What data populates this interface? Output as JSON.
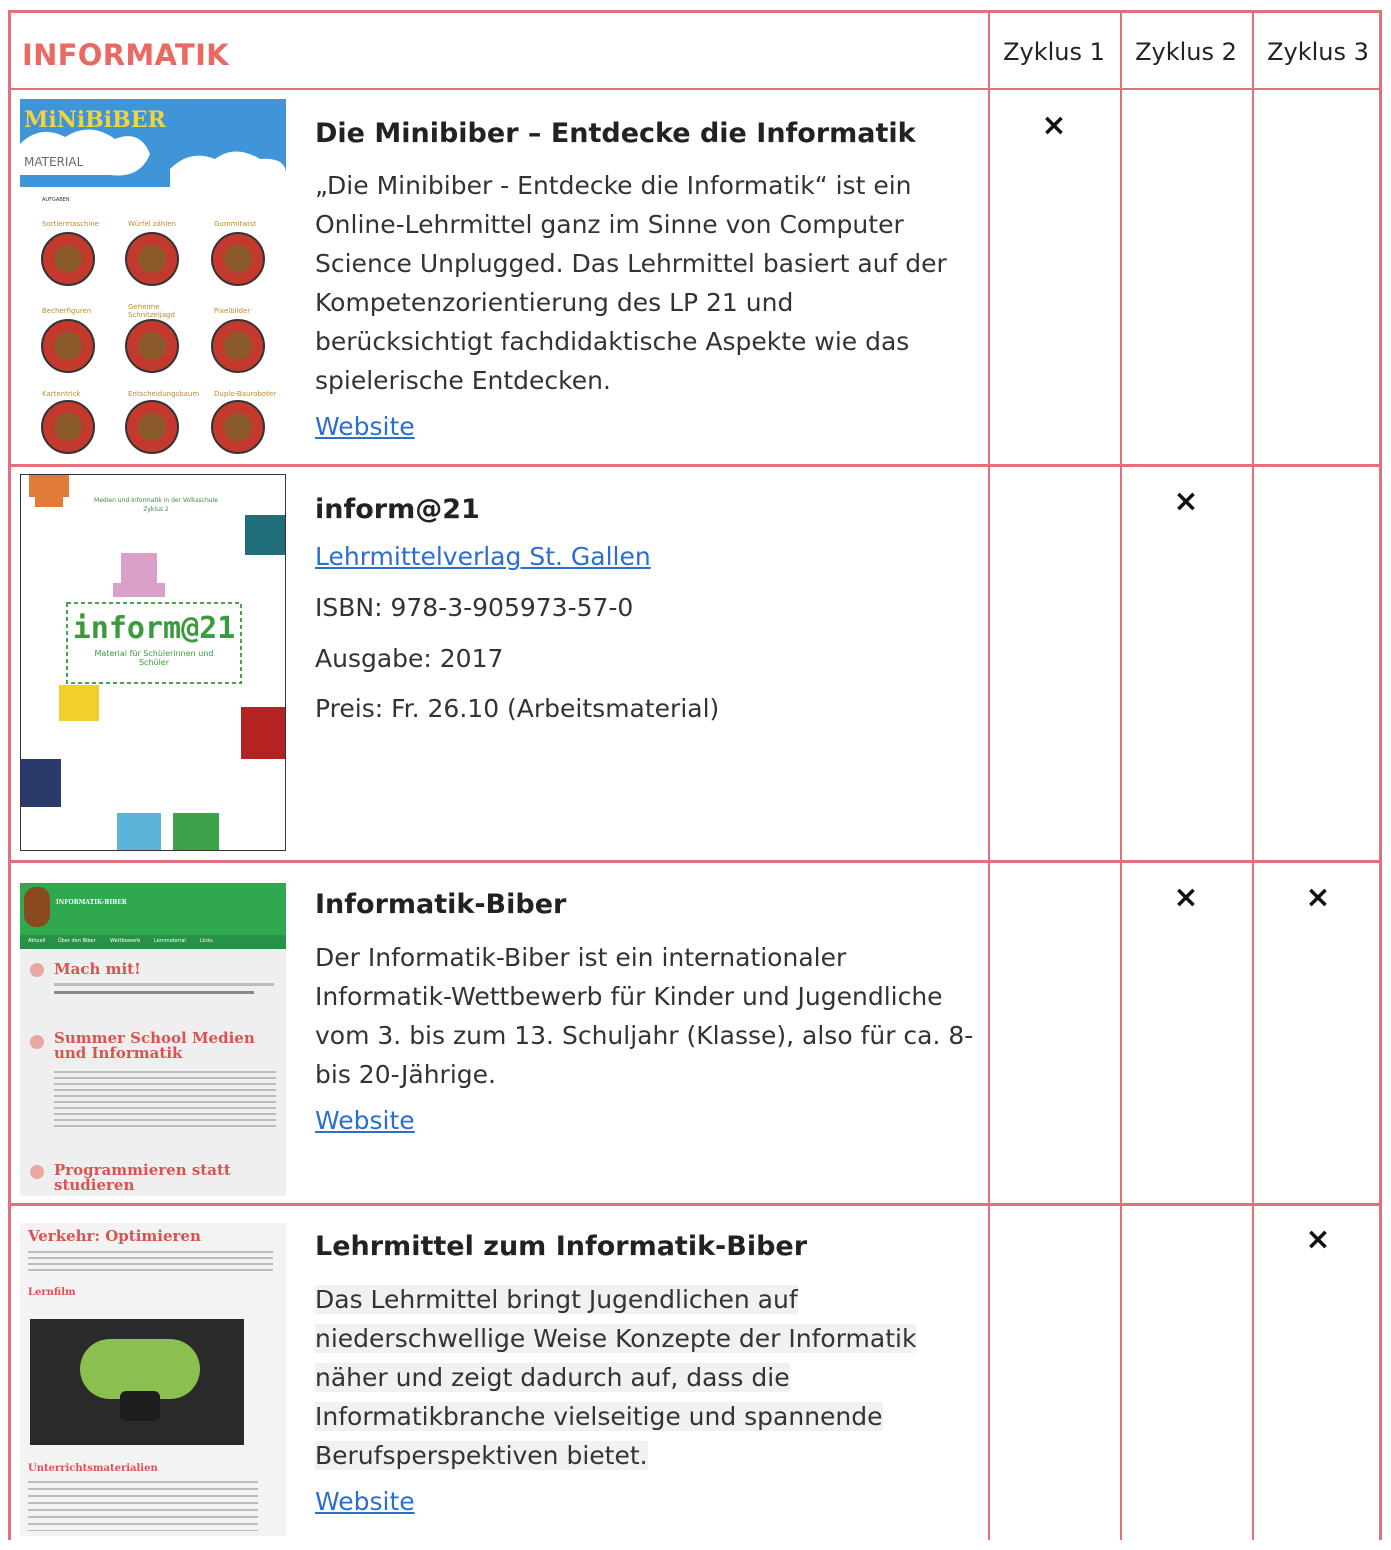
{
  "header": {
    "title": "INFORMATIK",
    "cycles": [
      "Zyklus 1",
      "Zyklus 2",
      "Zyklus 3"
    ]
  },
  "mark_symbol": "×",
  "rows": [
    {
      "title": "Die Minibiber – Entdecke die Informatik",
      "description": "„Die Minibiber - Entdecke die Informatik“ ist ein Online-Lehrmittel ganz im Sinne von Computer Science Unplugged. Das Lehrmittel basiert auf der Kompetenzorientierung des LP 21 und berücksichtigt fachdidaktische Aspekte wie das spielerische Entdecken.",
      "link": "Website",
      "cycles": [
        true,
        false,
        false
      ],
      "thumb": {
        "logo": "MiNiBiBER",
        "menu": "MATERIAL",
        "section": "AUFGABEN",
        "tasks": [
          "Sortiermaschine",
          "Würfel zählen",
          "Gummitwist",
          "Becherfiguren",
          "Geheime Schnitzeljagd",
          "Pixelbilder",
          "Kartentrick",
          "Entscheidungsbaum",
          "Duplo-Bauroboter"
        ]
      }
    },
    {
      "title": "inform@21",
      "link": "Lehrmittelverlag St. Gallen",
      "isbn": "ISBN: 978-3-905973-57-0",
      "edition": "Ausgabe: 2017",
      "price": "Preis: Fr. 26.10 (Arbeitsmaterial)",
      "cycles": [
        false,
        true,
        false
      ],
      "thumb": {
        "header": "Medien und Informatik in der Volksschule",
        "subheader": "Zyklus 2",
        "brand": "inform@21",
        "subtitle": "Material für Schülerinnen und Schüler"
      }
    },
    {
      "title": "Informatik-Biber",
      "description": "Der Informatik-Biber ist ein internationaler Informatik-Wettbewerb für Kinder und Jugendliche vom 3. bis zum 13. Schuljahr (Klasse), also für ca. 8- bis 20-Jährige.",
      "link": "Website",
      "cycles": [
        false,
        true,
        true
      ],
      "thumb": {
        "head": "INFORMATIK-BIBER",
        "nav": [
          "Aktuell",
          "Über den Biber",
          "Wettbewerb",
          "Lernmaterial",
          "Links"
        ],
        "posts": [
          "Mach mit!",
          "Summer School Medien und Informatik",
          "Programmieren statt studieren"
        ]
      }
    },
    {
      "title": "Lehrmittel zum Informatik-Biber",
      "description": "Das Lehrmittel bringt Jugendlichen auf niederschwellige Weise Konzepte der Informatik näher und zeigt dadurch auf, dass die Informatikbranche vielseitige und spannende Berufsperspektiven bietet.",
      "link": "Website",
      "cycles": [
        false,
        false,
        true
      ],
      "thumb": {
        "title": "Verkehr: Optimieren",
        "sub1": "Lernfilm",
        "sub2": "Unterrichtsmaterialien"
      }
    }
  ],
  "colors": {
    "border": "#e0707a",
    "title": "#e86a63",
    "link": "#2a6ed0"
  }
}
